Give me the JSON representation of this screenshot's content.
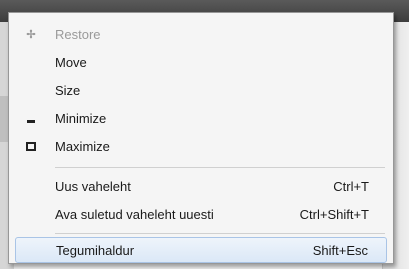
{
  "menu": {
    "items": [
      {
        "icon": "restore-icon",
        "label": "Restore",
        "shortcut": "",
        "disabled": true
      },
      {
        "icon": "",
        "label": "Move",
        "shortcut": ""
      },
      {
        "icon": "",
        "label": "Size",
        "shortcut": ""
      },
      {
        "icon": "minimize-icon",
        "label": "Minimize",
        "shortcut": ""
      },
      {
        "icon": "maximize-icon",
        "label": "Maximize",
        "shortcut": ""
      },
      {
        "icon": "",
        "label": "Uus vaheleht",
        "shortcut": "Ctrl+T"
      },
      {
        "icon": "",
        "label": "Ava suletud vaheleht uuesti",
        "shortcut": "Ctrl+Shift+T"
      },
      {
        "icon": "",
        "label": "Tegumihaldur",
        "shortcut": "Shift+Esc",
        "highlighted": true
      }
    ]
  }
}
